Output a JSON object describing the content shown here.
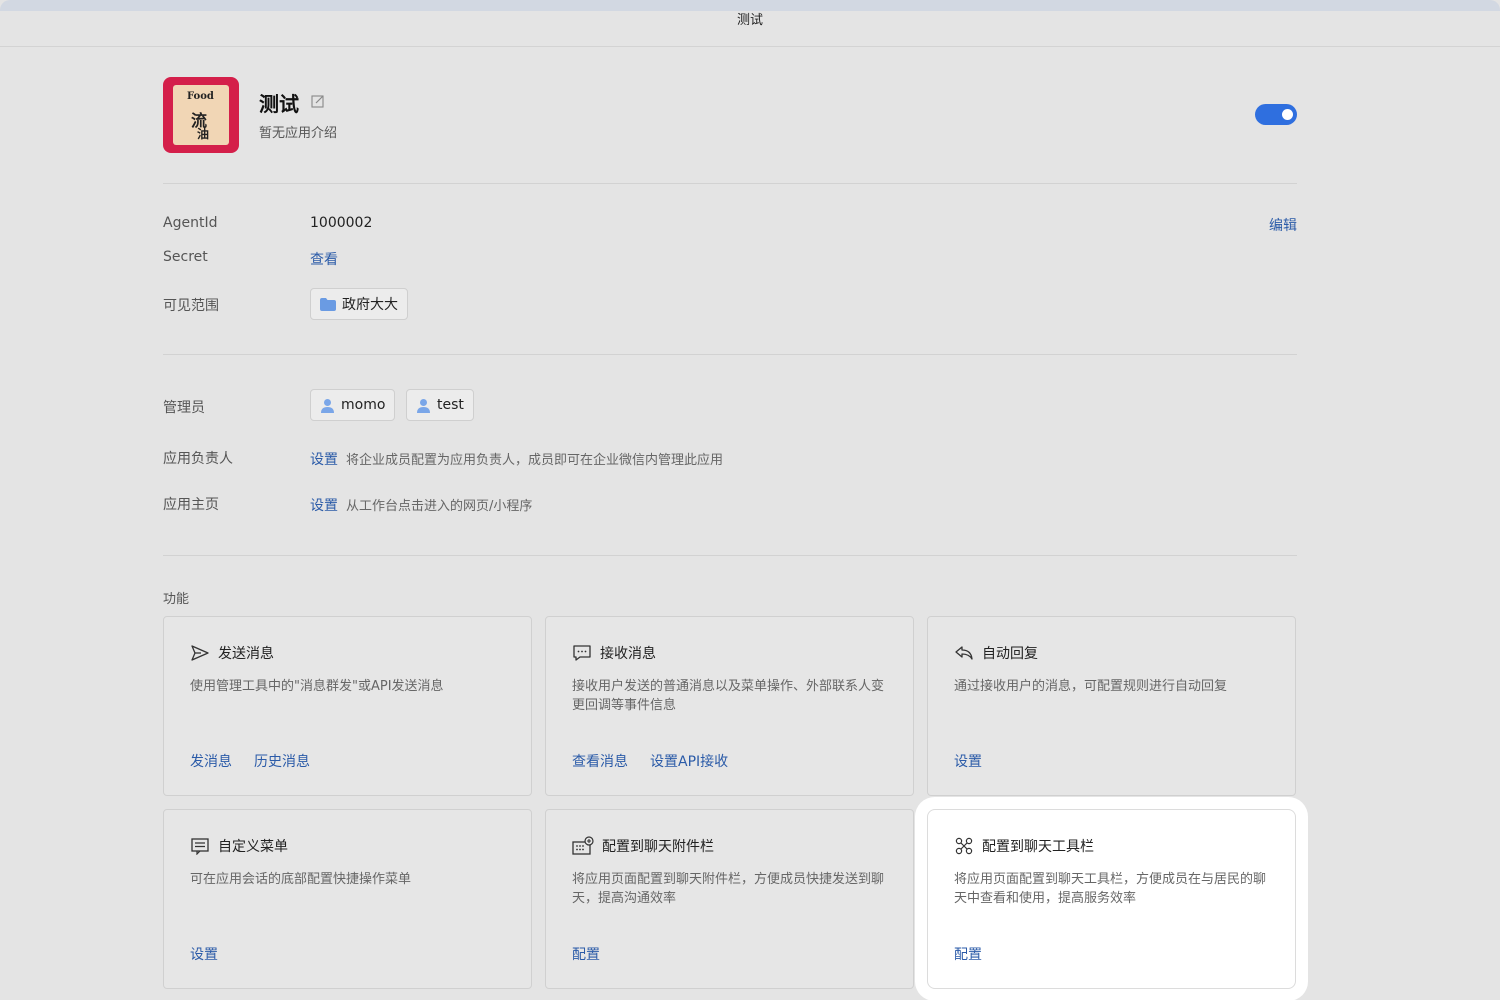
{
  "window": {
    "title": "测试"
  },
  "app": {
    "name": "测试",
    "description": "暂无应用介绍",
    "enabled": true,
    "logo_text": [
      "Food",
      "流",
      "油"
    ],
    "accent": "#2f6fdf"
  },
  "info": {
    "agentid_label": "AgentId",
    "agentid_value": "1000002",
    "edit_label": "编辑",
    "secret_label": "Secret",
    "secret_link": "查看",
    "visible_label": "可见范围",
    "visible_chip": "政府大大"
  },
  "admin": {
    "admin_label": "管理员",
    "admins": [
      "momo",
      "test"
    ],
    "owner_label": "应用负责人",
    "owner_link": "设置",
    "owner_hint": "将企业成员配置为应用负责人，成员即可在企业微信内管理此应用",
    "home_label": "应用主页",
    "home_link": "设置",
    "home_hint": "从工作台点击进入的网页/小程序"
  },
  "features": {
    "section_title": "功能",
    "cards": [
      {
        "title": "发送消息",
        "desc": "使用管理工具中的\"消息群发\"或API发送消息",
        "actions": [
          "发消息",
          "历史消息"
        ]
      },
      {
        "title": "接收消息",
        "desc": "接收用户发送的普通消息以及菜单操作、外部联系人变更回调等事件信息",
        "actions": [
          "查看消息",
          "设置API接收"
        ]
      },
      {
        "title": "自动回复",
        "desc": "通过接收用户的消息，可配置规则进行自动回复",
        "actions": [
          "设置"
        ]
      },
      {
        "title": "自定义菜单",
        "desc": "可在应用会话的底部配置快捷操作菜单",
        "actions": [
          "设置"
        ]
      },
      {
        "title": "配置到聊天附件栏",
        "desc": "将应用页面配置到聊天附件栏，方便成员快捷发送到聊天，提高沟通效率",
        "actions": [
          "配置"
        ]
      },
      {
        "title": "配置到聊天工具栏",
        "desc": "将应用页面配置到聊天工具栏，方便成员在与居民的聊天中查看和使用，提高服务效率",
        "actions": [
          "配置"
        ]
      }
    ]
  }
}
